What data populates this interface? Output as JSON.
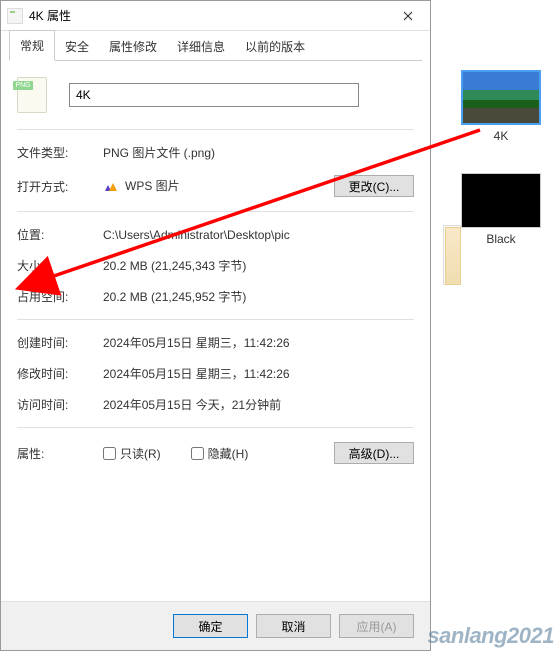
{
  "titlebar": {
    "title": "4K 属性"
  },
  "tabs": {
    "general": "常规",
    "security": "安全",
    "property_modify": "属性修改",
    "detail": "详细信息",
    "previous": "以前的版本"
  },
  "file": {
    "name": "4K",
    "icon_badge": "PNG"
  },
  "labels": {
    "type": "文件类型:",
    "open_with": "打开方式:",
    "change_btn": "更改(C)...",
    "location": "位置:",
    "size": "大小:",
    "size_on_disk": "占用空间:",
    "created": "创建时间:",
    "modified": "修改时间:",
    "accessed": "访问时间:",
    "attributes": "属性:",
    "readonly": "只读(R)",
    "hidden": "隐藏(H)",
    "advanced_btn": "高级(D)..."
  },
  "values": {
    "type": "PNG 图片文件 (.png)",
    "open_with": "WPS 图片",
    "location": "C:\\Users\\Administrator\\Desktop\\pic",
    "size": "20.2 MB (21,245,343 字节)",
    "size_on_disk": "20.2 MB (21,245,952 字节)",
    "created": "2024年05月15日 星期三，11:42:26",
    "modified": "2024年05月15日 星期三，11:42:26",
    "accessed": "2024年05月15日 今天，21分钟前"
  },
  "buttons": {
    "ok": "确定",
    "cancel": "取消",
    "apply": "应用(A)"
  },
  "thumbnails": {
    "thumb1_label": "4K",
    "thumb2_label": "Black"
  },
  "watermark": "sanlang2021"
}
